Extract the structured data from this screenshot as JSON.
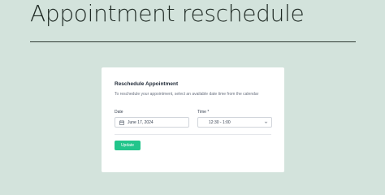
{
  "page": {
    "title": "Appointment reschedule"
  },
  "card": {
    "title": "Reschedule Appointment",
    "description": "To reschedule your appointment, select an available date time from the calendar",
    "date_label": "Date",
    "date_value": "June 17, 2024",
    "time_label": "Time *",
    "time_value": "12:30 - 1:00",
    "update_label": "Update"
  },
  "icons": {
    "date": "calendar-icon",
    "time_dropdown": "chevron-down-icon"
  },
  "colors": {
    "background": "#d3e3dc",
    "card": "#ffffff",
    "button": "#22c58b"
  }
}
